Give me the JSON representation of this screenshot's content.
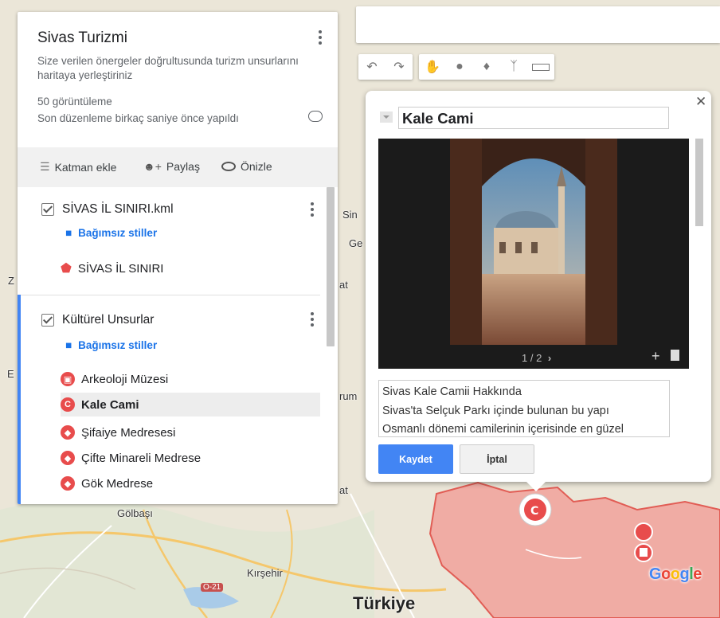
{
  "panel": {
    "title": "Sivas Turizmi",
    "description": "Size verilen önergeler doğrultusunda turizm unsurlarını haritaya yerleştiriniz",
    "views": "50 görüntüleme",
    "edited": "Son düzenleme birkaç saniye önce yapıldı",
    "actions": {
      "add_layer": "Katman ekle",
      "share": "Paylaş",
      "preview": "Önizle"
    },
    "layers": [
      {
        "name": "SİVAS İL SINIRI.kml",
        "style": "Bağımsız stiller",
        "items": [
          {
            "label": "SİVAS İL SINIRI",
            "icon": "polygon-icon"
          }
        ]
      },
      {
        "name": "Kültürel Unsurlar",
        "style": "Bağımsız stiller",
        "items": [
          {
            "label": "Arkeoloji Müzesi",
            "icon": "museum-icon"
          },
          {
            "label": "Kale Cami",
            "icon": "mosque-icon",
            "selected": true
          },
          {
            "label": "Şifaiye Medresesi",
            "icon": "school-icon"
          },
          {
            "label": "Çifte Minareli Medrese",
            "icon": "school-icon"
          },
          {
            "label": "Gök Medrese",
            "icon": "school-icon"
          }
        ]
      }
    ]
  },
  "info": {
    "title": "Kale Cami",
    "photo_counter": "1 / 2",
    "description_lines": [
      "Sivas Kale Camii Hakkında",
      "Sivas'ta Selçuk Parkı içinde bulunan bu yapı",
      "Osmanlı dönemi camilerinin içerisinde en güzel"
    ],
    "save_label": "Kaydet",
    "cancel_label": "İptal"
  },
  "map": {
    "labels": {
      "golbasi": "Gölbaşı",
      "kirsehir": "Kırşehir",
      "turkiye": "Türkiye",
      "road": "O-21",
      "sin": "Sin",
      "ge": "Ge",
      "at1": "at",
      "rum": "rum",
      "at2": "at",
      "z": "Z",
      "e": "E"
    },
    "logo": "Google"
  },
  "colors": {
    "accent": "#4285f4",
    "marker": "#e84c4c",
    "region": "#f28b82"
  }
}
